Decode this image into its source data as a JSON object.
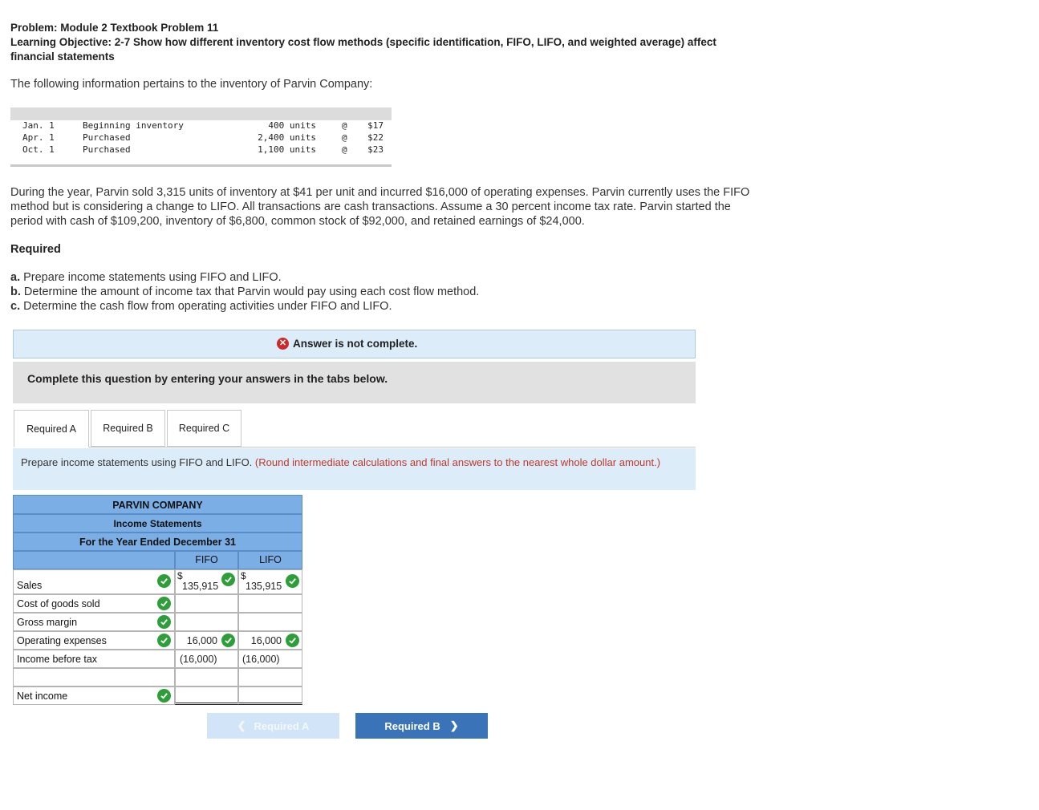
{
  "header": {
    "problem": "Problem: Module 2 Textbook Problem 11",
    "objective": "Learning Objective: 2-7 Show how different inventory cost flow methods (specific identification, FIFO, LIFO, and weighted average) affect financial statements"
  },
  "intro": "The following information pertains to the inventory of Parvin Company:",
  "inventory": [
    {
      "date": "Jan. 1",
      "desc": "Beginning inventory",
      "units": "400 units",
      "at": "@",
      "price": "$17"
    },
    {
      "date": "Apr. 1",
      "desc": "Purchased",
      "units": "2,400 units",
      "at": "@",
      "price": "$22"
    },
    {
      "date": "Oct. 1",
      "desc": "Purchased",
      "units": "1,100 units",
      "at": "@",
      "price": "$23"
    }
  ],
  "paragraph": "During the year, Parvin sold 3,315 units of inventory at $41 per unit and incurred $16,000 of operating expenses. Parvin currently uses the FIFO method but is considering a change to LIFO. All transactions are cash transactions. Assume a 30 percent income tax rate. Parvin started the period with cash of $109,200, inventory of $6,800, common stock of $92,000, and retained earnings of $24,000.",
  "required": {
    "title": "Required",
    "items": [
      {
        "letter": "a.",
        "text": " Prepare income statements using FIFO and LIFO."
      },
      {
        "letter": "b.",
        "text": " Determine the amount of income tax that Parvin would pay using each cost flow method."
      },
      {
        "letter": "c.",
        "text": " Determine the cash flow from operating activities under FIFO and LIFO."
      }
    ]
  },
  "alert": "Answer is not complete.",
  "complete_msg": "Complete this question by entering your answers in the tabs below.",
  "tabs": [
    "Required A",
    "Required B",
    "Required C"
  ],
  "instruction": {
    "main": "Prepare income statements using FIFO and LIFO. ",
    "note": "(Round intermediate calculations and final answers to the nearest whole dollar amount.)"
  },
  "statement": {
    "company": "PARVIN COMPANY",
    "title": "Income Statements",
    "period": "For the Year Ended December 31",
    "col_fifo": "FIFO",
    "col_lifo": "LIFO",
    "rows": {
      "sales": {
        "label": "Sales",
        "fifo": "135,915",
        "lifo": "135,915"
      },
      "cogs": {
        "label": "Cost of goods sold",
        "fifo": "",
        "lifo": ""
      },
      "gross": {
        "label": "Gross margin",
        "fifo": "",
        "lifo": ""
      },
      "opex": {
        "label": "Operating expenses",
        "fifo": "16,000",
        "lifo": "16,000"
      },
      "ibt": {
        "label": "Income before tax",
        "fifo": "(16,000)",
        "lifo": "(16,000)"
      },
      "net": {
        "label": "Net income",
        "fifo": "",
        "lifo": ""
      }
    },
    "dollar": "$"
  },
  "nav": {
    "prev": "Required A",
    "next": "Required B"
  },
  "colors": {
    "accent": "#3b73b9",
    "check": "#2e9e3a",
    "error": "#cc2a2a",
    "header_blue": "#7aaee5"
  }
}
